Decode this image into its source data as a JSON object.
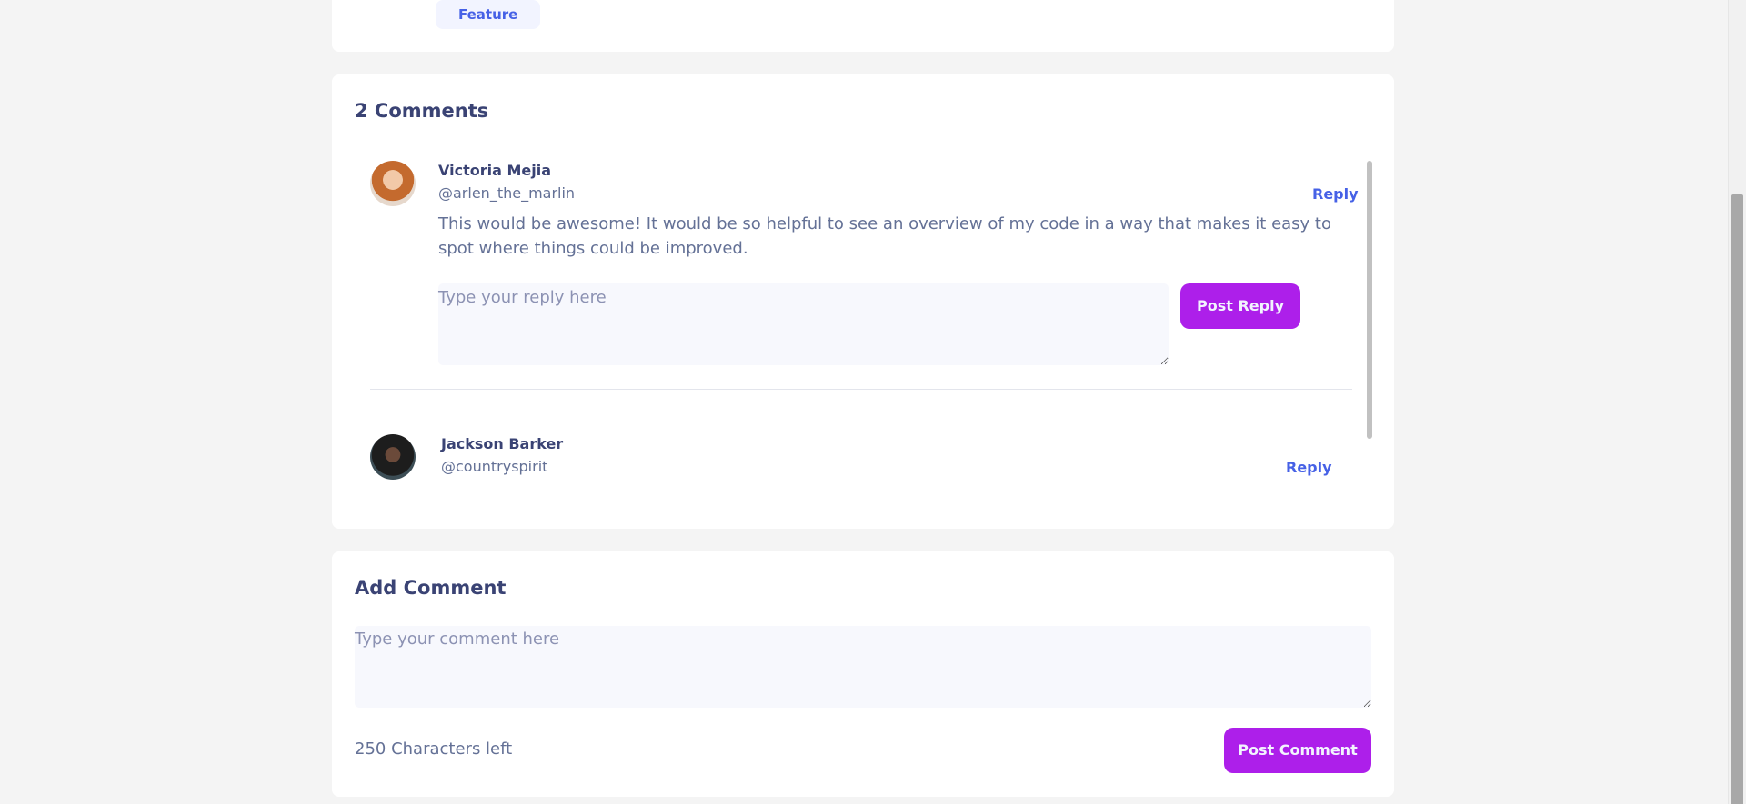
{
  "feedback": {
    "tag": "Feature"
  },
  "comments": {
    "title": "2 Comments",
    "items": [
      {
        "name": "Victoria Mejia",
        "handle": "@arlen_the_marlin",
        "reply_label": "Reply",
        "text": "This would be awesome! It would be so helpful to see an overview of my code in a way that makes it easy to spot where things could be improved.",
        "reply_placeholder": "Type your reply here",
        "post_reply_label": "Post Reply"
      },
      {
        "name": "Jackson Barker",
        "handle": "@countryspirit",
        "reply_label": "Reply"
      }
    ]
  },
  "add_comment": {
    "title": "Add Comment",
    "placeholder": "Type your comment here",
    "chars_left": "250 Characters left",
    "post_label": "Post Comment"
  },
  "colors": {
    "background": "#f4f4f4",
    "card": "#ffffff",
    "heading": "#3a4374",
    "muted": "#647196",
    "link": "#4661e6",
    "button": "#ad1fea",
    "input": "#f7f8fd"
  }
}
